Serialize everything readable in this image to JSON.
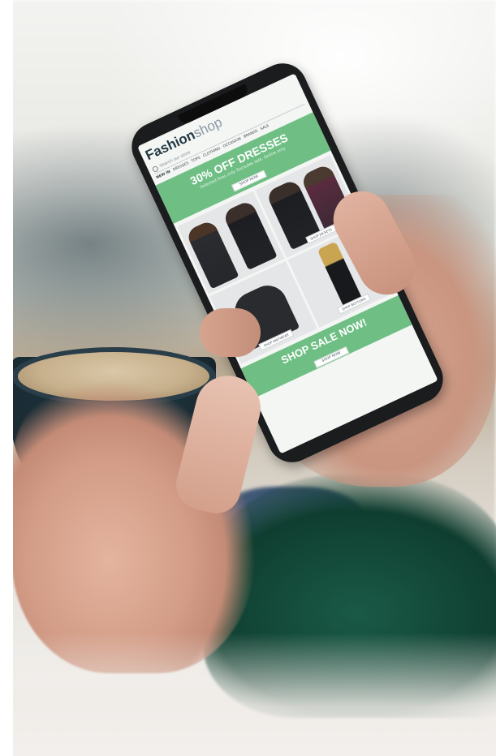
{
  "phone_screen": {
    "brand_primary": "Fashion",
    "brand_secondary": "shop",
    "search_placeholder": "Search our store",
    "nav_items": [
      "NEW IN",
      "DRESSES",
      "TOPS",
      "CLOTHING",
      "OCCASION",
      "BRANDS",
      "SALE"
    ],
    "promo_title": "30% OFF DRESSES",
    "promo_subtitle": "Selected lines only. Excludes sale. Online only.",
    "promo_button": "SHOP NOW",
    "tiles": [
      {
        "button": ""
      },
      {
        "button": "SHOP JACKETS"
      },
      {
        "button": "SHOP KNITWEAR"
      },
      {
        "button": "SHOP BOTTOMS"
      }
    ],
    "sale_title": "SHOP SALE NOW!",
    "sale_button": "SHOP NOW"
  },
  "colors": {
    "promo_green": "#6fbf85",
    "brand_dark": "#243a44",
    "sweater_green": "#1a5a46",
    "mug_blue": "#1e3540"
  }
}
